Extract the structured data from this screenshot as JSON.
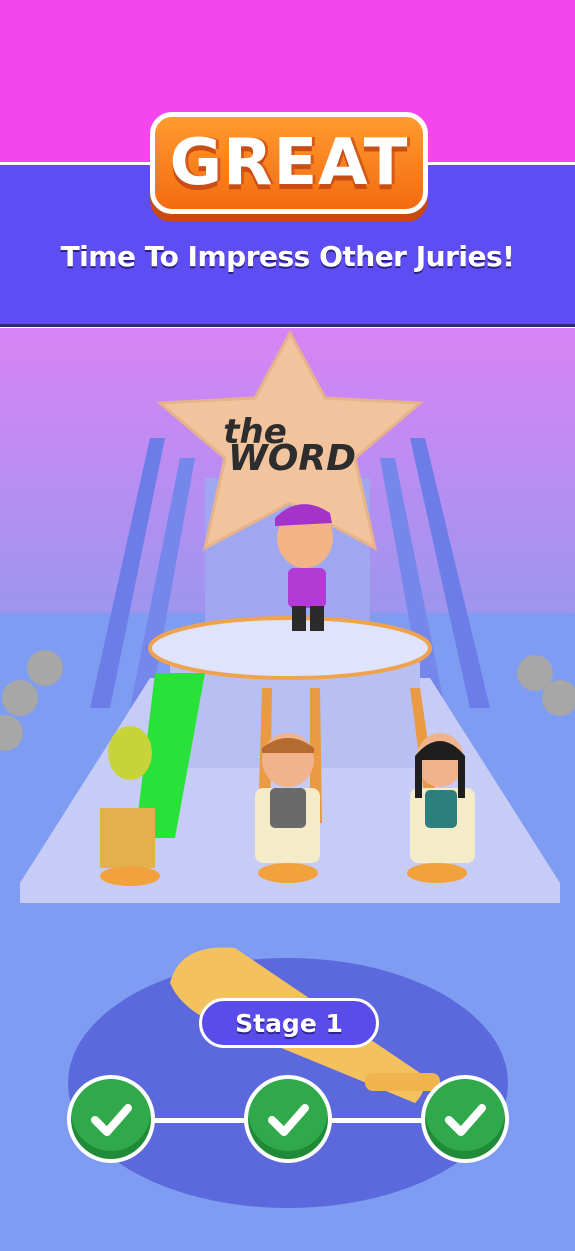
{
  "header": {
    "title": "GREAT",
    "subtitle": "Time To Impress Other Juries!"
  },
  "scene": {
    "logo_text_line1": "the",
    "logo_text_line2": "WORD"
  },
  "progress": {
    "stage_label": "Stage 1",
    "steps": [
      {
        "icon": "checkmark-icon",
        "status": "complete"
      },
      {
        "icon": "checkmark-icon",
        "status": "complete"
      },
      {
        "icon": "checkmark-icon",
        "status": "complete"
      }
    ]
  },
  "colors": {
    "magenta_top": "#f346ec",
    "banner": "#5e4df2",
    "title_orange": "#f46b10",
    "check_green": "#2fa94a",
    "stage_pill": "#5a4ce8"
  }
}
